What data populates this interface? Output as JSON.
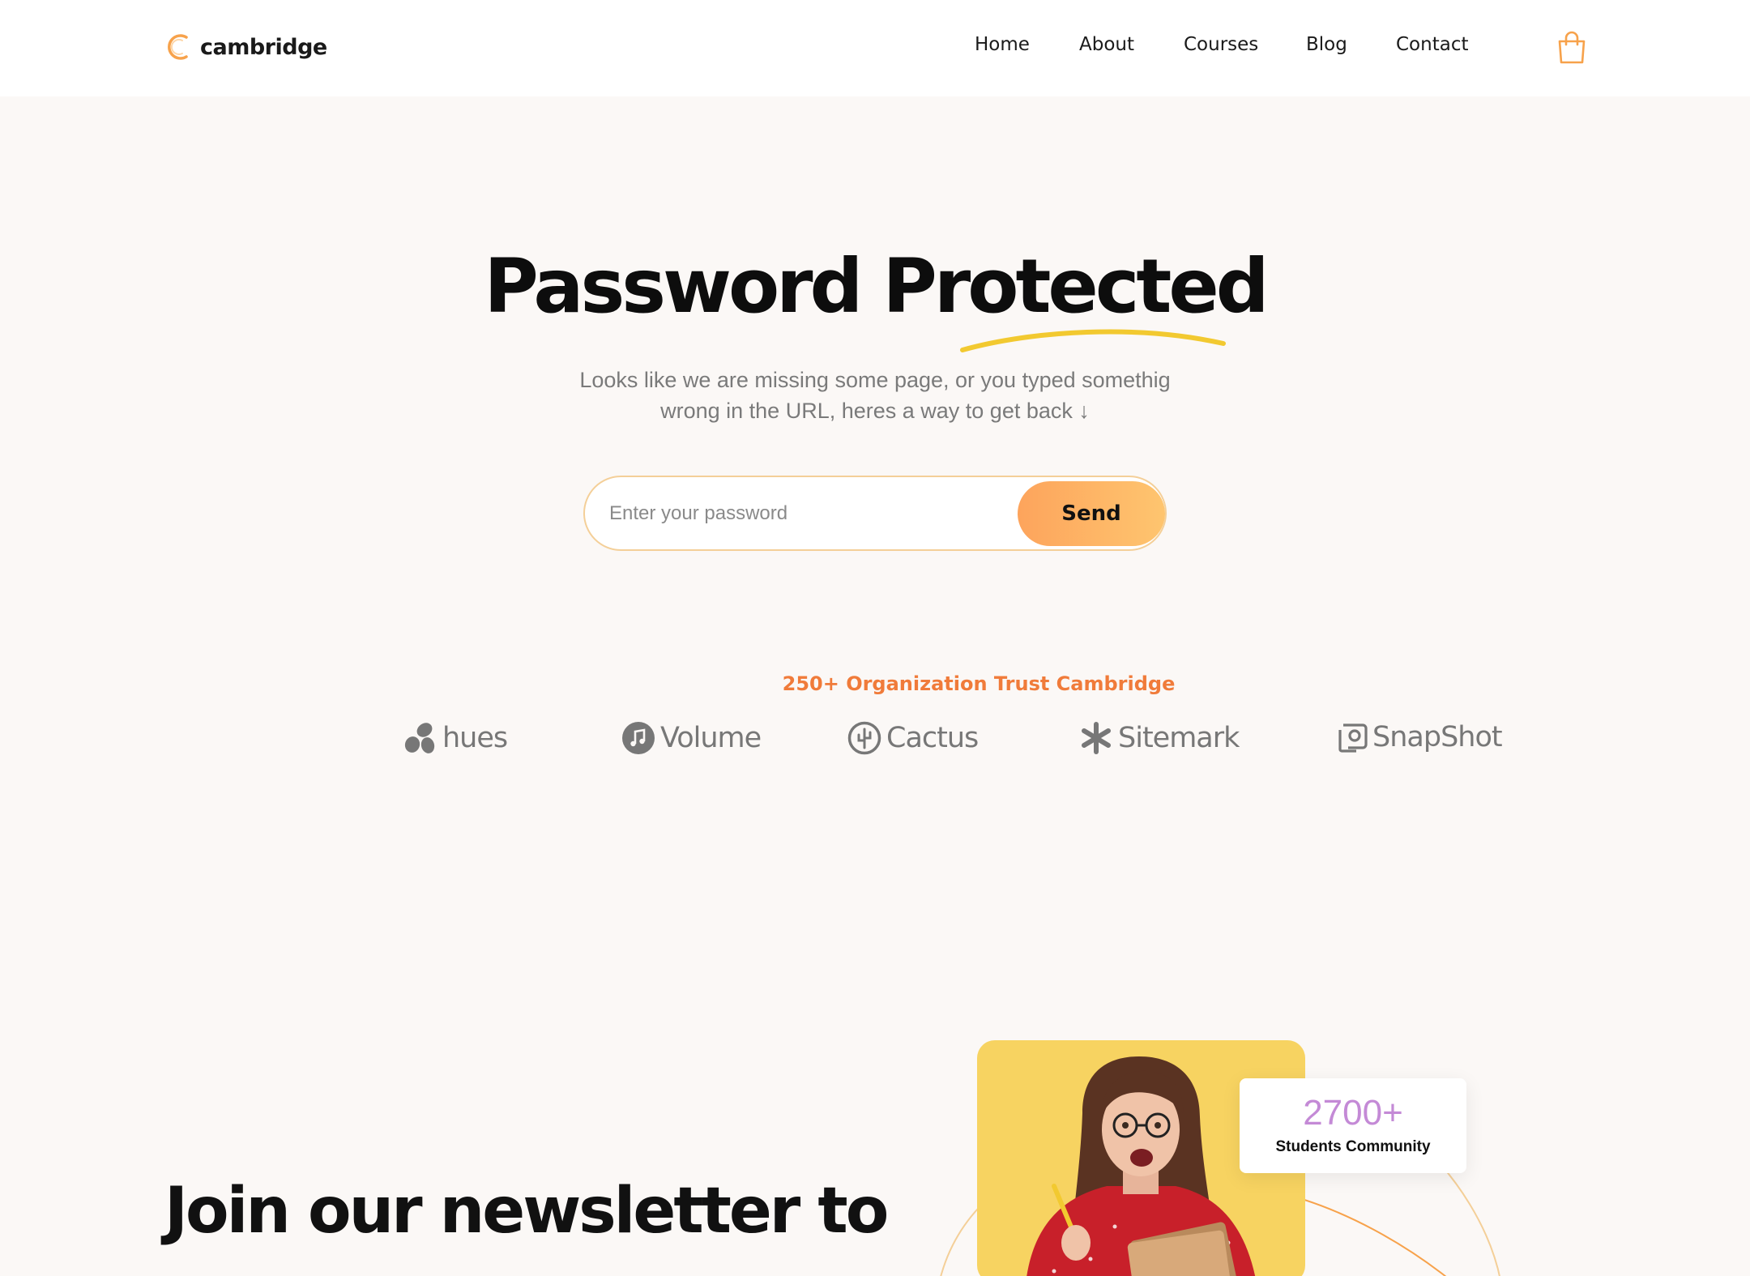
{
  "header": {
    "brand": "cambridge",
    "nav": [
      {
        "label": "Home"
      },
      {
        "label": "About"
      },
      {
        "label": "Courses"
      },
      {
        "label": "Blog"
      },
      {
        "label": "Contact"
      }
    ],
    "cart_icon": "shopping-bag-icon"
  },
  "hero": {
    "title": "Password Protected",
    "subtitle_line1": "Looks like we are missing some page, or you typed somethig",
    "subtitle_line2": "wrong in the URL, heres a way to get back ↓",
    "password_placeholder": "Enter your password",
    "password_value": "",
    "send_label": "Send"
  },
  "trust": {
    "heading": "250+ Organization Trust Cambridge",
    "brands": [
      {
        "name": "hues",
        "icon": "hues-logo-icon"
      },
      {
        "name": "Volume",
        "icon": "music-note-icon"
      },
      {
        "name": "Cactus",
        "icon": "cactus-icon"
      },
      {
        "name": "Sitemark",
        "icon": "asterisk-icon"
      },
      {
        "name": "SnapShot",
        "icon": "camera-icon"
      }
    ]
  },
  "newsletter": {
    "title_line1": "Join our newsletter to"
  },
  "stats": {
    "count": "2700+",
    "label": "Students Community"
  },
  "colors": {
    "accent_orange": "#f07b3a",
    "button_gradient_start": "#fda45c",
    "button_gradient_end": "#fec56f",
    "underline_yellow": "#f2c930",
    "stat_purple": "#c48ad6",
    "photo_bg": "#f7d361",
    "page_bg": "#fbf8f6"
  }
}
